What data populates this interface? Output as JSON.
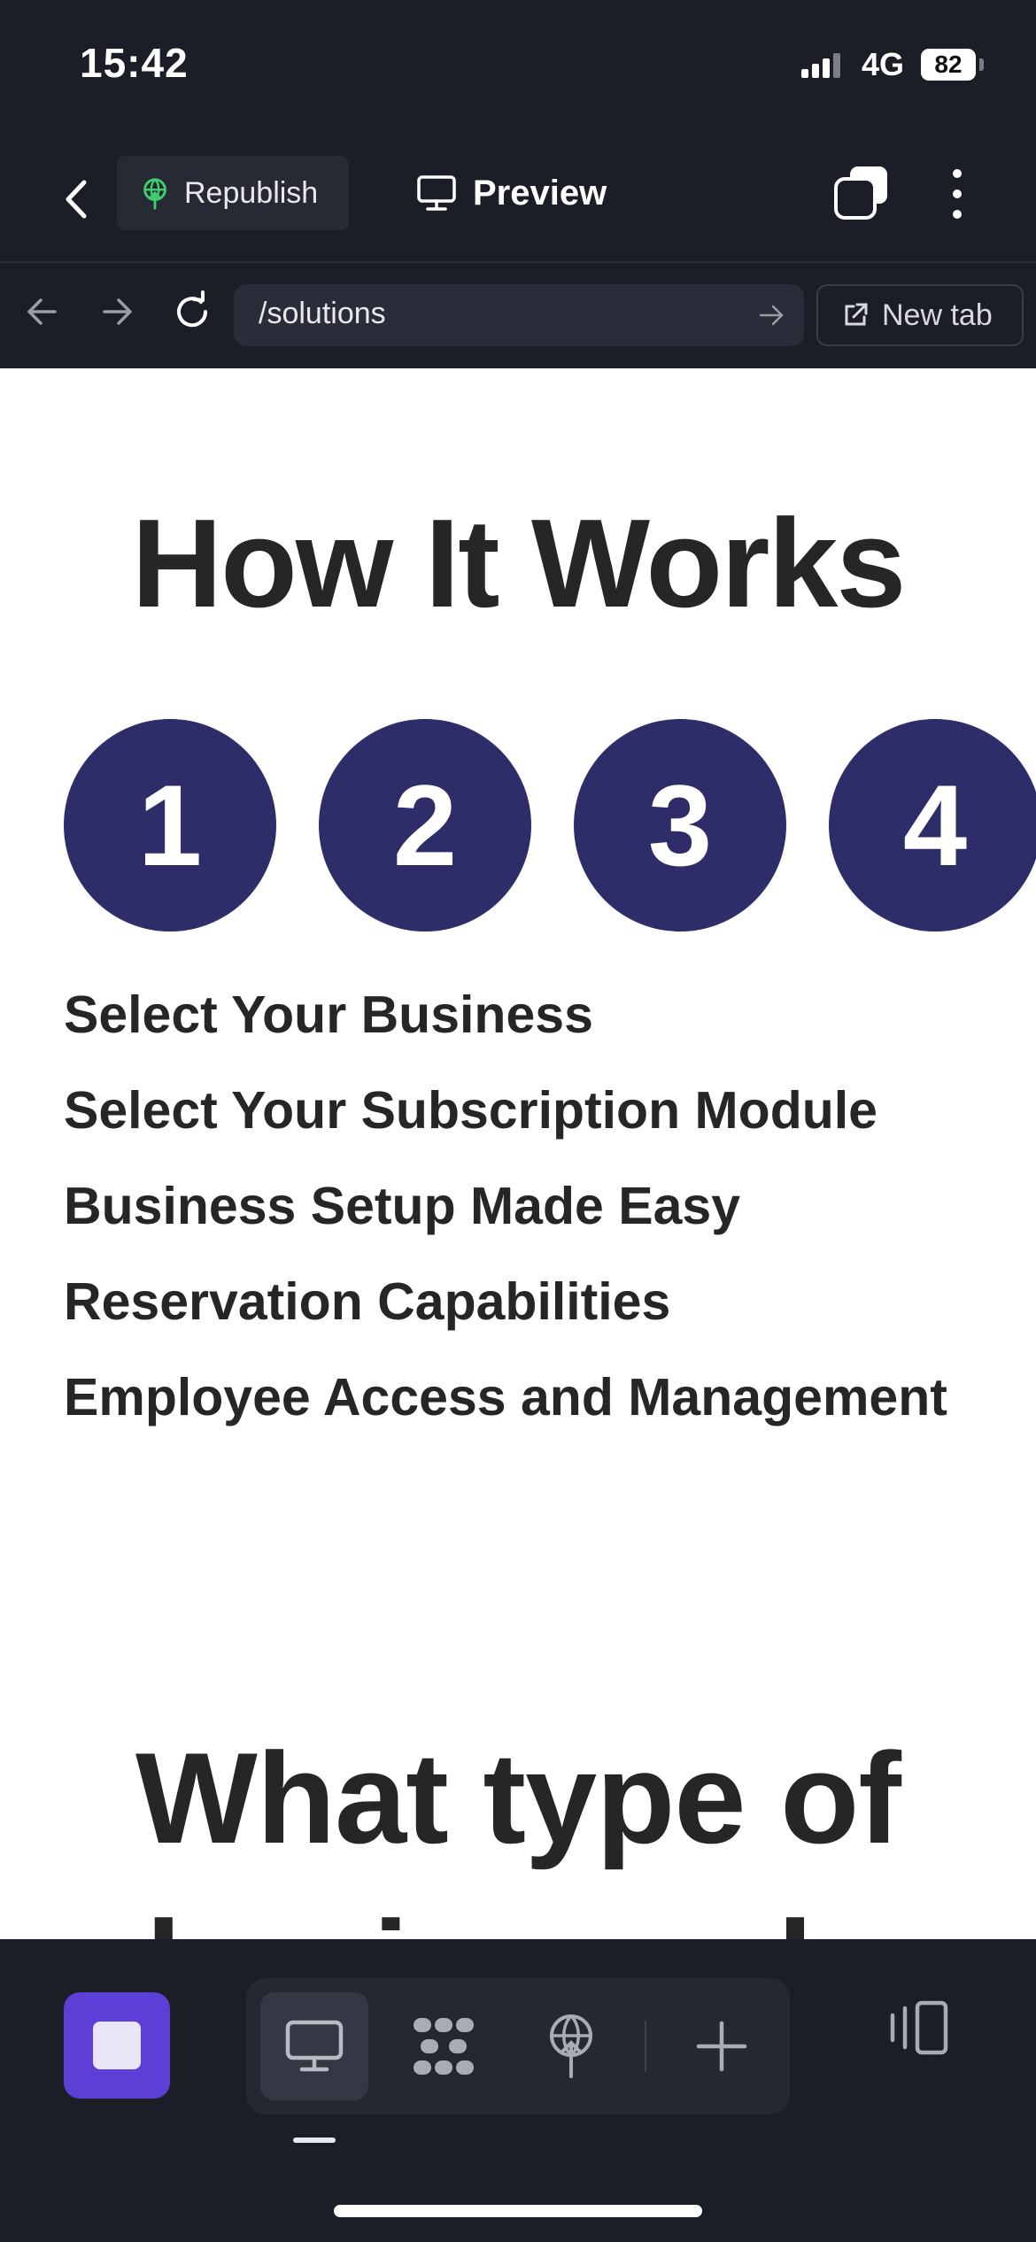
{
  "status_bar": {
    "time": "15:42",
    "network": "4G",
    "battery": "82"
  },
  "header": {
    "republish_label": "Republish",
    "preview_label": "Preview"
  },
  "browser": {
    "url": "/solutions",
    "new_tab_label": "New tab"
  },
  "page": {
    "section_title": "How It Works",
    "steps": [
      "1",
      "2",
      "3",
      "4"
    ],
    "features": [
      "Select Your Business",
      "Select Your Subscription Module",
      "Business Setup Made Easy",
      "Reservation Capabilities",
      "Employee Access and Management"
    ],
    "next_title": "What type of business do"
  },
  "colors": {
    "app_background": "#1b1d27",
    "step_circle": "#2e2c69",
    "accent_button": "#5b3fd6",
    "republish_icon": "#3ecf6e",
    "page_text": "#262626"
  },
  "toolbar": {
    "icons": [
      "stop-icon",
      "desktop-icon",
      "components-icon",
      "publish-icon",
      "add-icon",
      "panel-icon"
    ]
  }
}
